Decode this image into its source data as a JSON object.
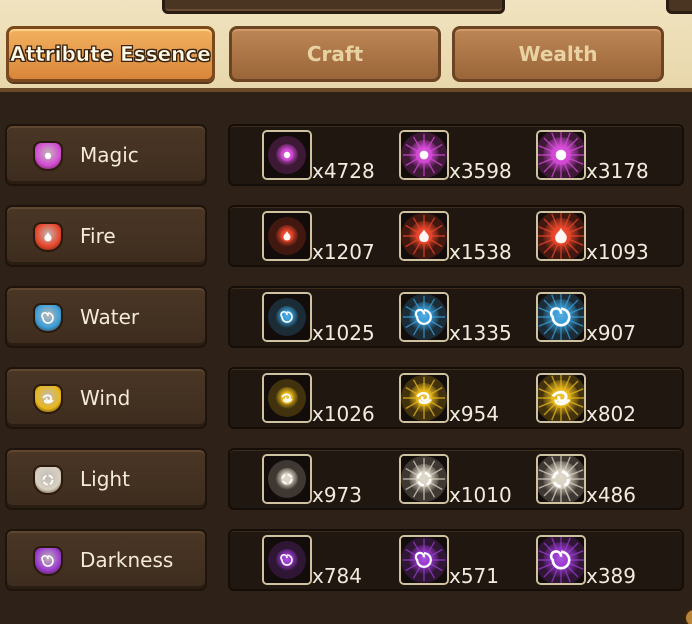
{
  "tabs": [
    {
      "label": "Attribute Essence",
      "active": true
    },
    {
      "label": "Craft",
      "active": false
    },
    {
      "label": "Wealth",
      "active": false
    }
  ],
  "rows": [
    {
      "label": "Magic",
      "icon": "magic-attribute-icon",
      "color": "#d44ad6",
      "items": [
        {
          "count": "x4728",
          "tier": "low"
        },
        {
          "count": "x3598",
          "tier": "mid"
        },
        {
          "count": "x3178",
          "tier": "high"
        }
      ]
    },
    {
      "label": "Fire",
      "icon": "fire-attribute-icon",
      "color": "#e8452a",
      "items": [
        {
          "count": "x1207",
          "tier": "low"
        },
        {
          "count": "x1538",
          "tier": "mid"
        },
        {
          "count": "x1093",
          "tier": "high"
        }
      ]
    },
    {
      "label": "Water",
      "icon": "water-attribute-icon",
      "color": "#3a9ed8",
      "items": [
        {
          "count": "x1025",
          "tier": "low"
        },
        {
          "count": "x1335",
          "tier": "mid"
        },
        {
          "count": "x907",
          "tier": "high"
        }
      ]
    },
    {
      "label": "Wind",
      "icon": "wind-attribute-icon",
      "color": "#e8b81c",
      "items": [
        {
          "count": "x1026",
          "tier": "low"
        },
        {
          "count": "x954",
          "tier": "mid"
        },
        {
          "count": "x802",
          "tier": "high"
        }
      ]
    },
    {
      "label": "Light",
      "icon": "light-attribute-icon",
      "color": "#d9d2c2",
      "items": [
        {
          "count": "x973",
          "tier": "low"
        },
        {
          "count": "x1010",
          "tier": "mid"
        },
        {
          "count": "x486",
          "tier": "high"
        }
      ]
    },
    {
      "label": "Darkness",
      "icon": "darkness-attribute-icon",
      "color": "#9a3ad0",
      "items": [
        {
          "count": "x784",
          "tier": "low"
        },
        {
          "count": "x571",
          "tier": "mid"
        },
        {
          "count": "x389",
          "tier": "high"
        }
      ]
    }
  ]
}
